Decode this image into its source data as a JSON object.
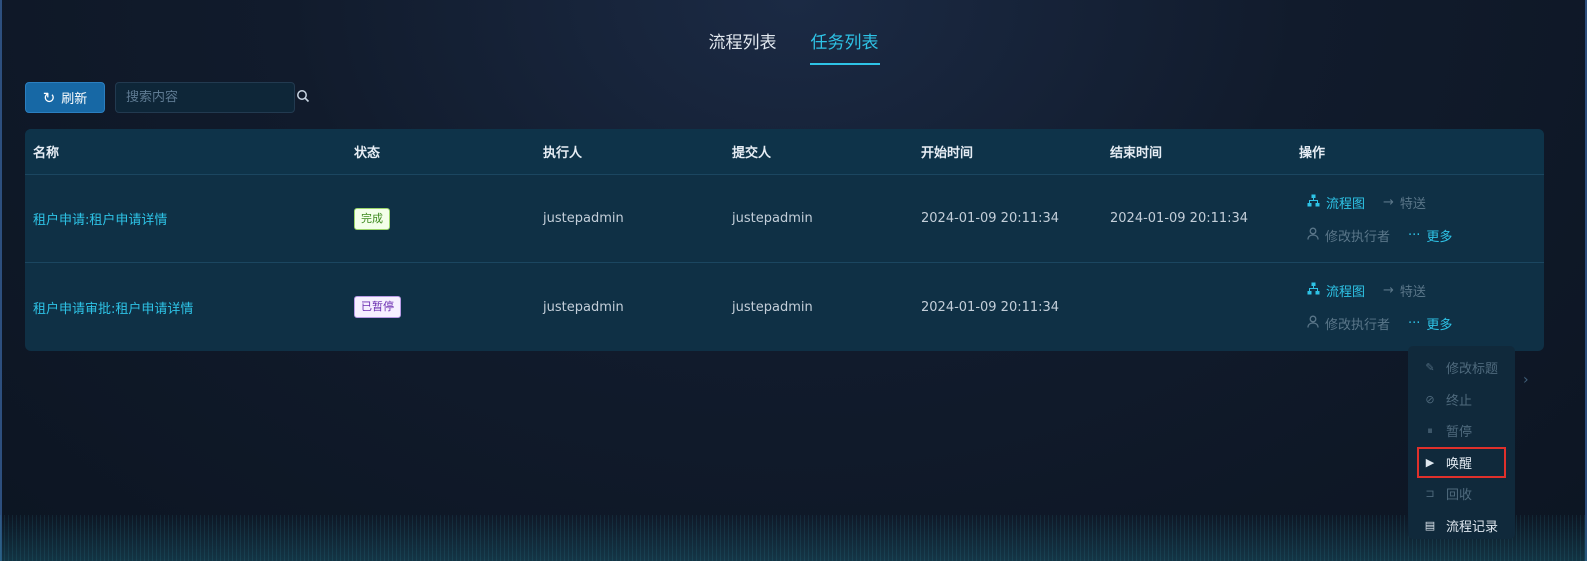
{
  "tabs": [
    {
      "label": "流程列表",
      "active": false
    },
    {
      "label": "任务列表",
      "active": true
    }
  ],
  "toolbar": {
    "refresh_label": "刷新",
    "search_placeholder": "搜索内容",
    "search_value": ""
  },
  "table": {
    "columns": [
      "名称",
      "状态",
      "执行人",
      "提交人",
      "开始时间",
      "结束时间",
      "操作"
    ],
    "rows": [
      {
        "name": "租户申请:租户申请详情",
        "status": "完成",
        "executor": "justepadmin",
        "submitter": "justepadmin",
        "start_time": "2024-01-09 20:11:34",
        "end_time": "2024-01-09 20:11:34"
      },
      {
        "name": "租户申请审批:租户申请详情",
        "status": "已暂停",
        "executor": "justepadmin",
        "submitter": "justepadmin",
        "start_time": "2024-01-09 20:11:34",
        "end_time": ""
      }
    ],
    "ops": {
      "flowchart": "流程图",
      "forward": "特送",
      "change_executor": "修改执行者",
      "more": "更多"
    }
  },
  "more_menu": {
    "items": [
      {
        "label": "修改标题",
        "enabled": false
      },
      {
        "label": "终止",
        "enabled": false
      },
      {
        "label": "暂停",
        "enabled": false
      },
      {
        "label": "唤醒",
        "enabled": true,
        "highlighted": true
      },
      {
        "label": "回收",
        "enabled": false
      },
      {
        "label": "流程记录",
        "enabled": true
      }
    ]
  },
  "colors": {
    "accent": "#2ec3e6",
    "button": "#1768a5",
    "highlight_border": "#e0302b"
  }
}
